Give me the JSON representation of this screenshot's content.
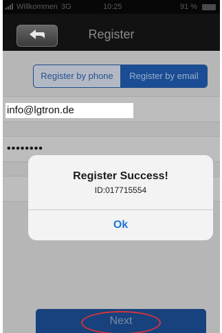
{
  "status_bar": {
    "carrier": "Willkommen",
    "network": "3G",
    "time": "10:25",
    "battery": "91 %"
  },
  "nav": {
    "title": "Register",
    "back_icon": "back-arrow-icon"
  },
  "register_tabs": [
    {
      "label": "Register by phone",
      "selected": false
    },
    {
      "label": "Register by email",
      "selected": true
    }
  ],
  "form": {
    "email_value": "info@lgtron.de",
    "password_value": "••••••••"
  },
  "dialog": {
    "title": "Register Success!",
    "message": "ID:017715554",
    "ok_label": "Ok"
  },
  "next_label": "Next",
  "colors": {
    "accent": "#1a4d93",
    "dialog_button": "#1d73d8",
    "annotation": "#d8343a"
  }
}
